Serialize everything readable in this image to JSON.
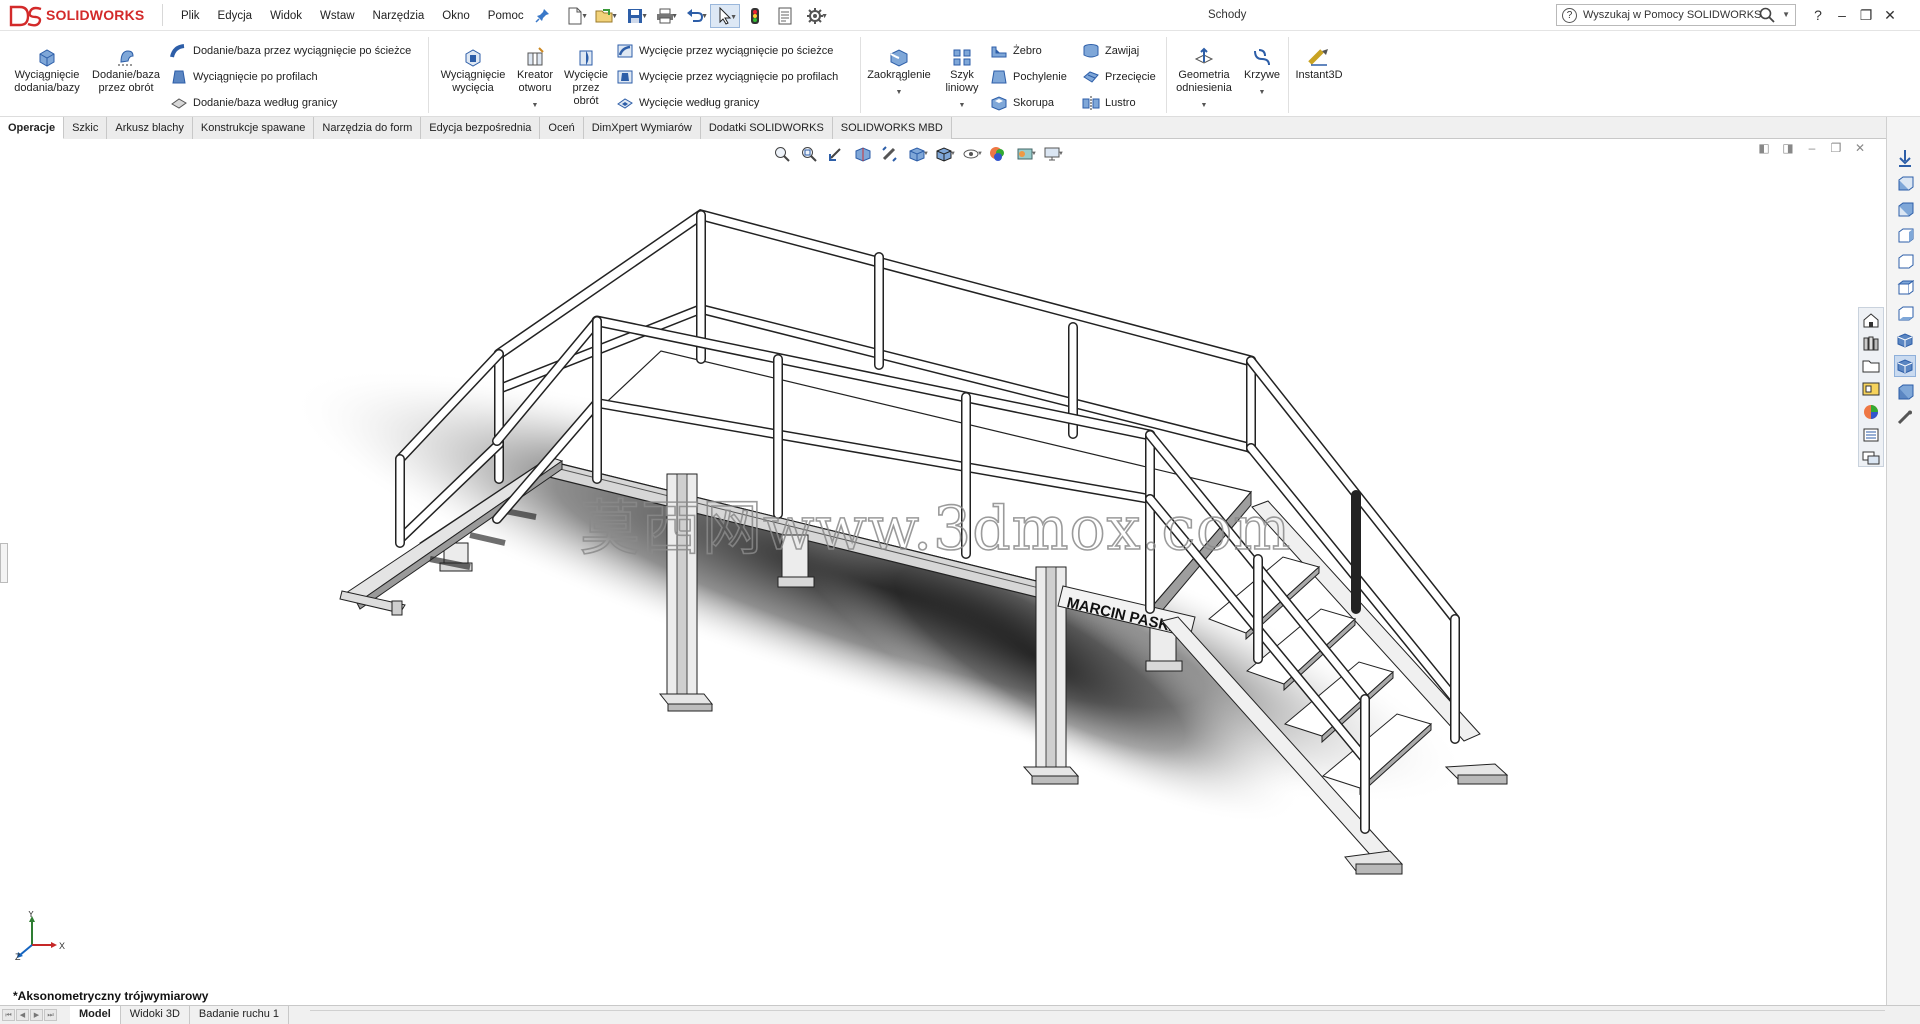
{
  "app": {
    "logo_text": "SOLIDWORKS",
    "logo_mark": "DS",
    "document_title": "Schody",
    "brand_color": "#d32a2a",
    "accent_color": "#3a78c8"
  },
  "menu": [
    "Plik",
    "Edycja",
    "Widok",
    "Wstaw",
    "Narzędzia",
    "Okno",
    "Pomoc"
  ],
  "quick_toolbar": {
    "icons": [
      "new-document-icon",
      "open-folder-icon",
      "save-icon",
      "print-icon",
      "undo-icon",
      "select-pointer-icon",
      "rebuild-icon",
      "file-properties-icon",
      "options-gear-icon"
    ]
  },
  "search": {
    "placeholder": "Wyszukaj w Pomocy SOLIDWORKS",
    "help_glyph": "?"
  },
  "window_controls": {
    "help": "?",
    "minimize": "–",
    "restore": "❐",
    "close": "✕"
  },
  "command_manager": {
    "features_big": {
      "extrude_boss": "Wyciągnięcie dodania/bazy",
      "revolve_boss": "Dodanie/baza przez obrót",
      "extrude_cut": "Wyciągnięcie wycięcia",
      "hole_wizard": "Kreator otworu",
      "revolve_cut": "Wycięcie przez obrót",
      "fillet": "Zaokrąglenie",
      "linear_pattern": "Szyk liniowy",
      "reference_geometry": "Geometria odniesienia",
      "curves": "Krzywe",
      "instant3d": "Instant3D"
    },
    "features_small": {
      "swept_boss": "Dodanie/baza przez wyciągnięcie po ścieżce",
      "lofted_boss": "Wyciągnięcie po profilach",
      "boundary_boss": "Dodanie/baza według granicy",
      "swept_cut": "Wycięcie przez wyciągnięcie po ścieżce",
      "lofted_cut": "Wycięcie przez wyciągnięcie po profilach",
      "boundary_cut": "Wycięcie według granicy",
      "rib": "Żebro",
      "draft": "Pochylenie",
      "shell": "Skorupa",
      "wrap": "Zawijaj",
      "intersect": "Przecięcie",
      "mirror": "Lustro"
    }
  },
  "tabs": [
    "Operacje",
    "Szkic",
    "Arkusz blachy",
    "Konstrukcje spawane",
    "Narzędzia do form",
    "Edycja bezpośrednia",
    "Oceń",
    "DimXpert Wymiarów",
    "Dodatki SOLIDWORKS",
    "SOLIDWORKS MBD"
  ],
  "active_tab": "Operacje",
  "viewport": {
    "view_name": "*Aksonometryczny trójwymiarowy",
    "engraved_label": "MARCIN PASKA",
    "watermark": "莫西网www.3dmox.com",
    "triad": {
      "x": "X",
      "y": "Y",
      "z": "Z"
    }
  },
  "bottom_tabs": [
    "Model",
    "Widoki 3D",
    "Badanie ruchu 1"
  ],
  "active_bottom_tab": "Model"
}
